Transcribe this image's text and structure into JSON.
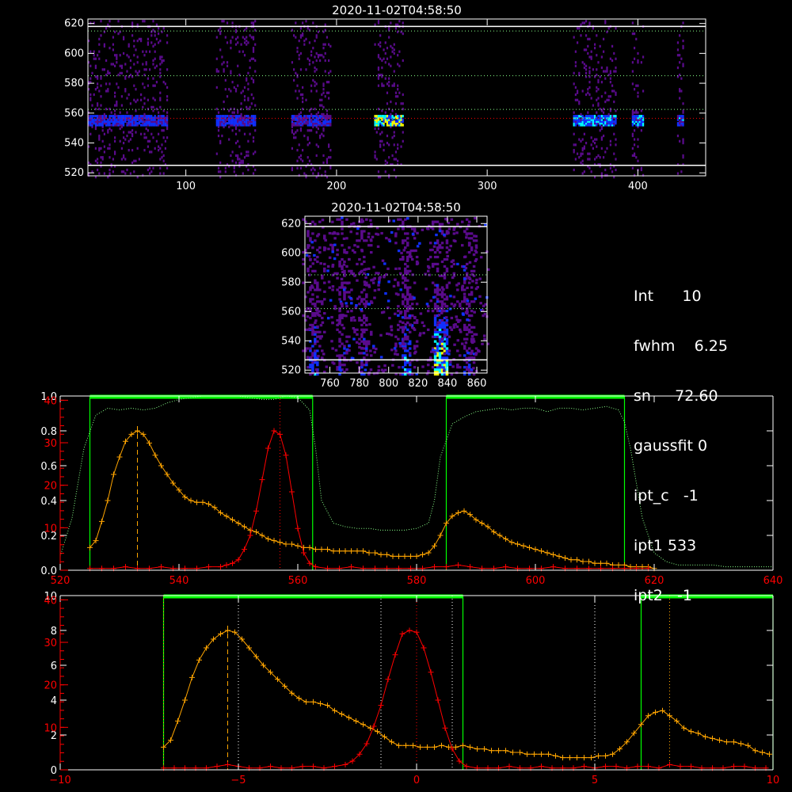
{
  "colors": {
    "background": "#000000",
    "axis": "#ffffff",
    "red_axis": "#ff0000",
    "orange": "#ffa500",
    "red": "#ff0000",
    "green": "#00ff00",
    "green_dotted": "#88ff88",
    "heat_low": "#5a0b8c",
    "heat_mid": "#1030ff",
    "heat_high": "#00ffff",
    "heat_peak": "#ffff00"
  },
  "stats": [
    {
      "label": "Int",
      "value": "10"
    },
    {
      "label": "fwhm",
      "value": "6.25"
    },
    {
      "label": "sn",
      "value": "72.60"
    },
    {
      "label": "gaussfit",
      "value": "0"
    },
    {
      "label": "ipt_c",
      "value": "-1"
    },
    {
      "label": "ipt1",
      "value": "533"
    },
    {
      "label": "ipt2",
      "value": "-1"
    }
  ],
  "chart_data": [
    {
      "type": "heatmap",
      "title": "2020-11-02T04:58:50",
      "xlim": [
        35,
        445
      ],
      "ylim": [
        518,
        623
      ],
      "xticks": [
        100,
        200,
        300,
        400
      ],
      "yticks": [
        520,
        540,
        560,
        580,
        600,
        620
      ],
      "hlines_white": [
        525,
        618
      ],
      "hlines_green_dotted": [
        562.5,
        585,
        615
      ],
      "hline_red_dotted": 556.5,
      "emission_bands": [
        {
          "x": [
            35,
            88
          ],
          "center": 556,
          "intensity": 0.45
        },
        {
          "x": [
            120,
            146
          ],
          "center": 556,
          "intensity": 0.45
        },
        {
          "x": [
            170,
            196
          ],
          "center": 556,
          "intensity": 0.35
        },
        {
          "x": [
            225,
            244
          ],
          "center": 556,
          "intensity": 0.85
        },
        {
          "x": [
            357,
            385
          ],
          "center": 556,
          "intensity": 0.6
        },
        {
          "x": [
            396,
            404
          ],
          "center": 556,
          "intensity": 0.6
        },
        {
          "x": [
            426,
            430
          ],
          "center": 556,
          "intensity": 0.5
        }
      ]
    },
    {
      "type": "heatmap",
      "title": "2020-11-02T04:58:50",
      "xlim": [
        743,
        867
      ],
      "ylim": [
        518,
        625
      ],
      "xticks": [
        760,
        780,
        800,
        820,
        840,
        860
      ],
      "yticks": [
        520,
        540,
        560,
        580,
        600,
        620
      ],
      "hlines_white": [
        527,
        618
      ],
      "hlines_green_dotted": [
        562,
        585
      ],
      "emission_columns": [
        {
          "x": [
            745,
            752
          ],
          "intensity": 0.5
        },
        {
          "x": [
            765,
            770
          ],
          "intensity": 0.35
        },
        {
          "x": [
            780,
            785
          ],
          "intensity": 0.4
        },
        {
          "x": [
            808,
            815
          ],
          "intensity": 0.55
        },
        {
          "x": [
            830,
            840
          ],
          "intensity": 0.9
        },
        {
          "x": [
            850,
            856
          ],
          "intensity": 0.4
        }
      ]
    },
    {
      "type": "line",
      "xlim": [
        520,
        640
      ],
      "ylim_left": [
        0,
        1.0
      ],
      "ylim_right": [
        0,
        41
      ],
      "xticks": [
        520,
        540,
        560,
        580,
        600,
        620,
        640
      ],
      "yticks_left": [
        0.0,
        0.2,
        0.4,
        0.6,
        0.8,
        1.0
      ],
      "yticks_right": [
        0,
        10,
        20,
        30,
        40
      ],
      "vline_orange_dashed": 533,
      "vline_red_dotted": 557,
      "green_boxes": [
        [
          525,
          562.5
        ],
        [
          585,
          615
        ]
      ],
      "series": [
        {
          "color": "orange",
          "x": [
            525,
            526,
            527,
            528,
            529,
            530,
            531,
            532,
            533,
            534,
            535,
            536,
            537,
            538,
            539,
            540,
            541,
            542,
            543,
            544,
            545,
            546,
            547,
            548,
            549,
            550,
            551,
            552,
            553,
            554,
            555,
            556,
            557,
            558,
            559,
            560,
            561,
            562,
            563,
            564,
            565,
            566,
            567,
            568,
            569,
            570,
            571,
            572,
            573,
            574,
            575,
            576,
            577,
            578,
            579,
            580,
            581,
            582,
            583,
            584,
            585,
            586,
            587,
            588,
            589,
            590,
            591,
            592,
            593,
            594,
            595,
            596,
            597,
            598,
            599,
            600,
            601,
            602,
            603,
            604,
            605,
            606,
            607,
            608,
            609,
            610,
            611,
            612,
            613,
            614,
            615,
            616,
            617,
            618,
            619,
            620
          ],
          "y": [
            0.13,
            0.17,
            0.28,
            0.4,
            0.55,
            0.65,
            0.74,
            0.78,
            0.8,
            0.78,
            0.73,
            0.66,
            0.6,
            0.55,
            0.5,
            0.46,
            0.42,
            0.4,
            0.39,
            0.39,
            0.38,
            0.36,
            0.33,
            0.31,
            0.29,
            0.27,
            0.25,
            0.23,
            0.22,
            0.2,
            0.18,
            0.17,
            0.16,
            0.15,
            0.15,
            0.14,
            0.13,
            0.13,
            0.12,
            0.12,
            0.12,
            0.11,
            0.11,
            0.11,
            0.11,
            0.11,
            0.11,
            0.1,
            0.1,
            0.09,
            0.09,
            0.08,
            0.08,
            0.08,
            0.08,
            0.08,
            0.09,
            0.1,
            0.14,
            0.2,
            0.27,
            0.31,
            0.33,
            0.34,
            0.32,
            0.29,
            0.27,
            0.25,
            0.22,
            0.2,
            0.18,
            0.16,
            0.15,
            0.14,
            0.13,
            0.12,
            0.11,
            0.1,
            0.09,
            0.08,
            0.07,
            0.06,
            0.06,
            0.05,
            0.05,
            0.04,
            0.04,
            0.04,
            0.03,
            0.03,
            0.03,
            0.02,
            0.02,
            0.02,
            0.02,
            0.01
          ]
        },
        {
          "color": "red",
          "x": [
            525,
            527,
            529,
            531,
            533,
            535,
            537,
            539,
            541,
            543,
            545,
            547,
            548,
            549,
            550,
            551,
            552,
            553,
            554,
            555,
            556,
            557,
            558,
            559,
            560,
            561,
            562,
            563,
            565,
            567,
            569,
            571,
            573,
            575,
            577,
            579,
            581,
            583,
            585,
            587,
            589,
            591,
            593,
            595,
            597,
            599,
            601,
            603,
            605,
            607,
            609,
            611,
            613,
            615,
            617,
            619
          ],
          "y": [
            0.01,
            0.01,
            0.01,
            0.02,
            0.01,
            0.01,
            0.02,
            0.01,
            0.01,
            0.01,
            0.02,
            0.02,
            0.03,
            0.04,
            0.06,
            0.12,
            0.2,
            0.34,
            0.52,
            0.7,
            0.8,
            0.78,
            0.66,
            0.45,
            0.24,
            0.1,
            0.04,
            0.02,
            0.01,
            0.01,
            0.02,
            0.01,
            0.01,
            0.01,
            0.01,
            0.01,
            0.01,
            0.02,
            0.02,
            0.03,
            0.02,
            0.01,
            0.01,
            0.02,
            0.01,
            0.01,
            0.01,
            0.02,
            0.01,
            0.01,
            0.01,
            0.01,
            0.01,
            0.01,
            0.01,
            0.01
          ]
        },
        {
          "color": "green_dotted",
          "x": [
            520,
            522,
            524,
            526,
            528,
            530,
            532,
            534,
            536,
            538,
            540,
            542,
            544,
            546,
            548,
            550,
            552,
            554,
            556,
            558,
            560,
            562,
            563,
            564,
            566,
            568,
            570,
            572,
            574,
            576,
            578,
            580,
            582,
            583,
            584,
            586,
            588,
            590,
            592,
            594,
            596,
            598,
            600,
            602,
            604,
            606,
            608,
            610,
            612,
            614,
            615,
            616,
            618,
            620,
            622,
            624,
            626,
            628,
            630,
            632,
            634,
            636,
            638,
            640
          ],
          "y": [
            0.08,
            0.3,
            0.7,
            0.89,
            0.93,
            0.92,
            0.93,
            0.92,
            0.93,
            0.96,
            0.98,
            0.99,
            1.0,
            1.0,
            1.0,
            1.0,
            0.99,
            0.98,
            0.98,
            1.0,
            0.99,
            0.92,
            0.7,
            0.4,
            0.27,
            0.25,
            0.24,
            0.24,
            0.23,
            0.23,
            0.23,
            0.24,
            0.27,
            0.4,
            0.65,
            0.84,
            0.88,
            0.91,
            0.92,
            0.93,
            0.92,
            0.93,
            0.93,
            0.91,
            0.93,
            0.93,
            0.92,
            0.93,
            0.94,
            0.92,
            0.85,
            0.7,
            0.3,
            0.1,
            0.05,
            0.03,
            0.03,
            0.03,
            0.03,
            0.02,
            0.02,
            0.02,
            0.02,
            0.02
          ]
        }
      ]
    },
    {
      "type": "line",
      "xlim": [
        -10,
        10
      ],
      "ylim_left": [
        0,
        10
      ],
      "ylim_right": [
        0,
        41
      ],
      "xticks": [
        -10,
        -5,
        0,
        5,
        10
      ],
      "yticks_left": [
        0,
        2,
        4,
        6,
        8,
        10
      ],
      "yticks_right": [
        0,
        10,
        20,
        30,
        40
      ],
      "vline_orange_dashed": -5.3,
      "vlines_white_dotted": [
        -5.0,
        -1.0,
        1.0,
        5.0
      ],
      "vline_red_dotted": 0,
      "vlines_orange_dotted": [
        -7.1,
        7.1
      ],
      "green_boxes": [
        [
          -7.1,
          1.3
        ],
        [
          6.3,
          10
        ]
      ],
      "series": [
        {
          "color": "orange",
          "x": [
            -7.1,
            -6.9,
            -6.7,
            -6.5,
            -6.3,
            -6.1,
            -5.9,
            -5.7,
            -5.5,
            -5.3,
            -5.1,
            -4.9,
            -4.7,
            -4.5,
            -4.3,
            -4.1,
            -3.9,
            -3.7,
            -3.5,
            -3.3,
            -3.1,
            -2.9,
            -2.7,
            -2.5,
            -2.3,
            -2.1,
            -1.9,
            -1.7,
            -1.5,
            -1.3,
            -1.1,
            -0.9,
            -0.7,
            -0.5,
            -0.3,
            -0.1,
            0.1,
            0.3,
            0.5,
            0.7,
            0.9,
            1.1,
            1.3,
            1.5,
            1.7,
            1.9,
            2.1,
            2.3,
            2.5,
            2.7,
            2.9,
            3.1,
            3.3,
            3.5,
            3.7,
            3.9,
            4.1,
            4.3,
            4.5,
            4.7,
            4.9,
            5.1,
            5.3,
            5.5,
            5.7,
            5.9,
            6.1,
            6.3,
            6.5,
            6.7,
            6.9,
            7.1,
            7.3,
            7.5,
            7.7,
            7.9,
            8.1,
            8.3,
            8.5,
            8.7,
            8.9,
            9.1,
            9.3,
            9.5,
            9.7,
            9.9
          ],
          "y": [
            1.3,
            1.7,
            2.8,
            4.0,
            5.3,
            6.3,
            7.0,
            7.5,
            7.8,
            8.0,
            7.9,
            7.5,
            7.0,
            6.5,
            6.0,
            5.6,
            5.2,
            4.8,
            4.4,
            4.1,
            3.9,
            3.9,
            3.8,
            3.7,
            3.4,
            3.2,
            3.0,
            2.8,
            2.6,
            2.4,
            2.2,
            1.9,
            1.6,
            1.4,
            1.4,
            1.4,
            1.3,
            1.3,
            1.3,
            1.4,
            1.3,
            1.3,
            1.4,
            1.3,
            1.2,
            1.2,
            1.1,
            1.1,
            1.1,
            1.0,
            1.0,
            0.9,
            0.9,
            0.9,
            0.9,
            0.8,
            0.7,
            0.7,
            0.7,
            0.7,
            0.7,
            0.8,
            0.8,
            0.9,
            1.2,
            1.6,
            2.1,
            2.6,
            3.1,
            3.3,
            3.4,
            3.1,
            2.8,
            2.4,
            2.2,
            2.1,
            1.9,
            1.8,
            1.7,
            1.6,
            1.6,
            1.5,
            1.4,
            1.1,
            1.0,
            0.9
          ]
        },
        {
          "color": "red",
          "x": [
            -7.1,
            -6.8,
            -6.5,
            -6.2,
            -5.9,
            -5.6,
            -5.3,
            -5.0,
            -4.7,
            -4.4,
            -4.1,
            -3.8,
            -3.5,
            -3.2,
            -2.9,
            -2.6,
            -2.3,
            -2.0,
            -1.8,
            -1.6,
            -1.4,
            -1.2,
            -1.0,
            -0.8,
            -0.6,
            -0.4,
            -0.2,
            0.0,
            0.2,
            0.4,
            0.6,
            0.8,
            1.0,
            1.2,
            1.4,
            1.7,
            2.0,
            2.3,
            2.6,
            2.9,
            3.2,
            3.5,
            3.8,
            4.1,
            4.4,
            4.7,
            5.0,
            5.3,
            5.6,
            5.9,
            6.2,
            6.5,
            6.8,
            7.1,
            7.4,
            7.7,
            8.0,
            8.3,
            8.6,
            8.9,
            9.2,
            9.5,
            9.8
          ],
          "y": [
            0.1,
            0.1,
            0.1,
            0.1,
            0.1,
            0.2,
            0.3,
            0.2,
            0.1,
            0.1,
            0.2,
            0.1,
            0.1,
            0.2,
            0.2,
            0.1,
            0.2,
            0.3,
            0.5,
            0.9,
            1.5,
            2.5,
            3.7,
            5.2,
            6.6,
            7.8,
            8.0,
            7.9,
            7.0,
            5.6,
            4.0,
            2.4,
            1.2,
            0.5,
            0.2,
            0.1,
            0.1,
            0.1,
            0.2,
            0.1,
            0.1,
            0.2,
            0.1,
            0.1,
            0.1,
            0.2,
            0.1,
            0.2,
            0.2,
            0.1,
            0.2,
            0.2,
            0.1,
            0.3,
            0.2,
            0.2,
            0.1,
            0.1,
            0.1,
            0.2,
            0.2,
            0.1,
            0.1
          ]
        }
      ]
    }
  ]
}
